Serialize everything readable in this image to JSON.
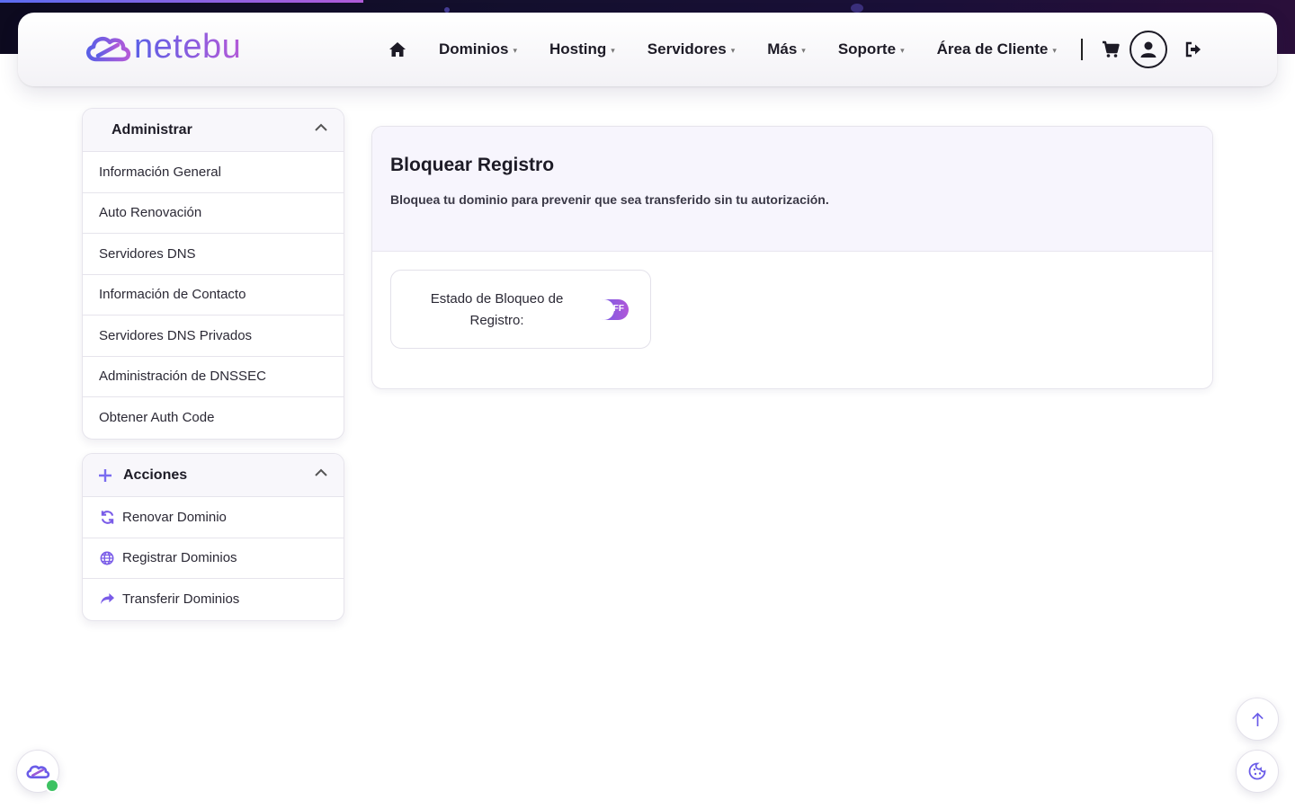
{
  "brand": {
    "name": "netebu"
  },
  "nav": {
    "items": [
      {
        "label": "Dominios"
      },
      {
        "label": "Hosting"
      },
      {
        "label": "Servidores"
      },
      {
        "label": "Más"
      },
      {
        "label": "Soporte"
      },
      {
        "label": "Área de Cliente"
      }
    ],
    "caret": "▾"
  },
  "sidebar": {
    "manage": {
      "title": "Administrar",
      "items": [
        {
          "label": "Información General"
        },
        {
          "label": "Auto Renovación"
        },
        {
          "label": "Servidores DNS"
        },
        {
          "label": "Información de Contacto"
        },
        {
          "label": "Servidores DNS Privados"
        },
        {
          "label": "Administración de DNSSEC"
        },
        {
          "label": "Obtener Auth Code"
        }
      ]
    },
    "actions": {
      "title": "Acciones",
      "items": [
        {
          "label": "Renovar Dominio",
          "icon": "refresh-icon"
        },
        {
          "label": "Registrar Dominios",
          "icon": "globe-icon"
        },
        {
          "label": "Transferir Dominios",
          "icon": "share-arrow-icon"
        }
      ]
    }
  },
  "main": {
    "title": "Bloquear Registro",
    "description": "Bloquea tu dominio para prevenir que sea transferido sin tu autorización.",
    "lock_status_label": "Estado de Bloqueo de Registro:",
    "toggle_text": "OFF"
  },
  "colors": {
    "accent_start": "#5a5fe6",
    "accent_end": "#b35ad8",
    "whatsapp": "#3dc262"
  }
}
